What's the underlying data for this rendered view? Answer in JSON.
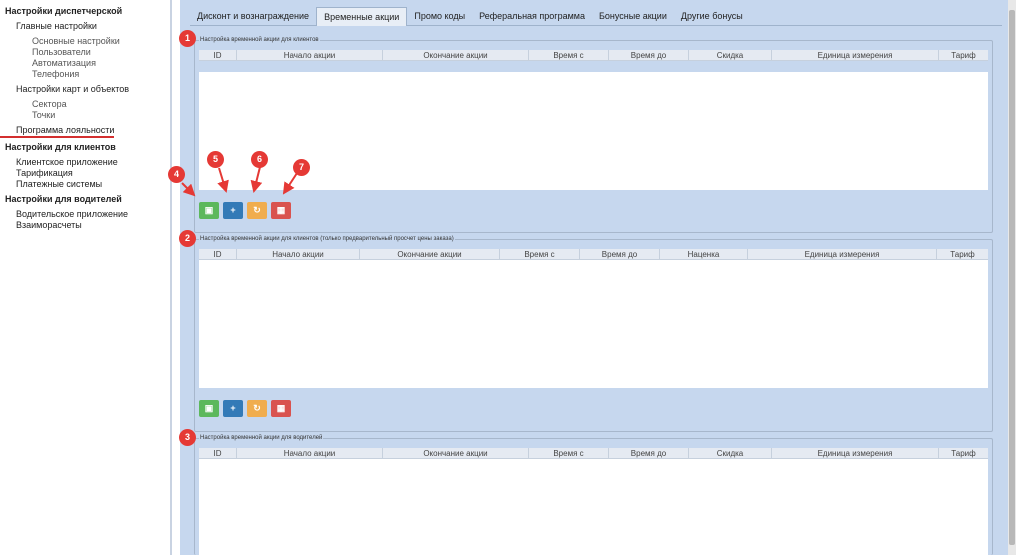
{
  "sidebar": {
    "s1": "Настройки диспетчерской",
    "main_settings": "Главные настройки",
    "basic": "Основные настройки",
    "users": "Пользователи",
    "automation": "Автоматизация",
    "telephony": "Телефония",
    "maps": "Настройки карт и объектов",
    "sectors": "Сектора",
    "points": "Точки",
    "loyalty": "Программа лояльности",
    "s2": "Настройки для клиентов",
    "client_app": "Клиентское приложение",
    "tariffs": "Тарификация",
    "payments": "Платежные системы",
    "s3": "Настройки для водителей",
    "driver_app": "Водительское приложение",
    "settlements": "Взаиморасчеты"
  },
  "tabs": [
    "Дисконт и вознаграждение",
    "Временные акции",
    "Промо коды",
    "Реферальная программа",
    "Бонусные акции",
    "Другие бонусы"
  ],
  "active_tab": "Временные акции",
  "groups": [
    {
      "legend": "Настройка временной акции для клиентов",
      "columns": [
        "ID",
        "Начало акции",
        "Окончание акции",
        "Время с",
        "Время до",
        "Скидка",
        "Единица измерения",
        "Тариф"
      ]
    },
    {
      "legend": "Настройка временной акции для клиентов (только предварительный просчет цены заказа)",
      "columns": [
        "ID",
        "Начало акции",
        "Окончание акции",
        "Время с",
        "Время до",
        "Наценка",
        "Единица измерения",
        "Тариф"
      ]
    },
    {
      "legend": "Настройка временной акции для водителей",
      "columns": [
        "ID",
        "Начало акции",
        "Окончание акции",
        "Время с",
        "Время до",
        "Скидка",
        "Единица измерения",
        "Тариф"
      ]
    }
  ],
  "buttons": {
    "save_icon": "floppy-icon",
    "add_icon": "plus-icon",
    "refresh_icon": "refresh-icon",
    "delete_icon": "trash-icon"
  },
  "annotations": [
    "1",
    "2",
    "3",
    "4",
    "5",
    "6",
    "7"
  ],
  "colors": {
    "main_bg": "#c6d7ee",
    "badge": "#e53935",
    "save": "#5cb85c",
    "add": "#337ab7",
    "refresh": "#f0ad4e",
    "delete": "#d9534f"
  }
}
